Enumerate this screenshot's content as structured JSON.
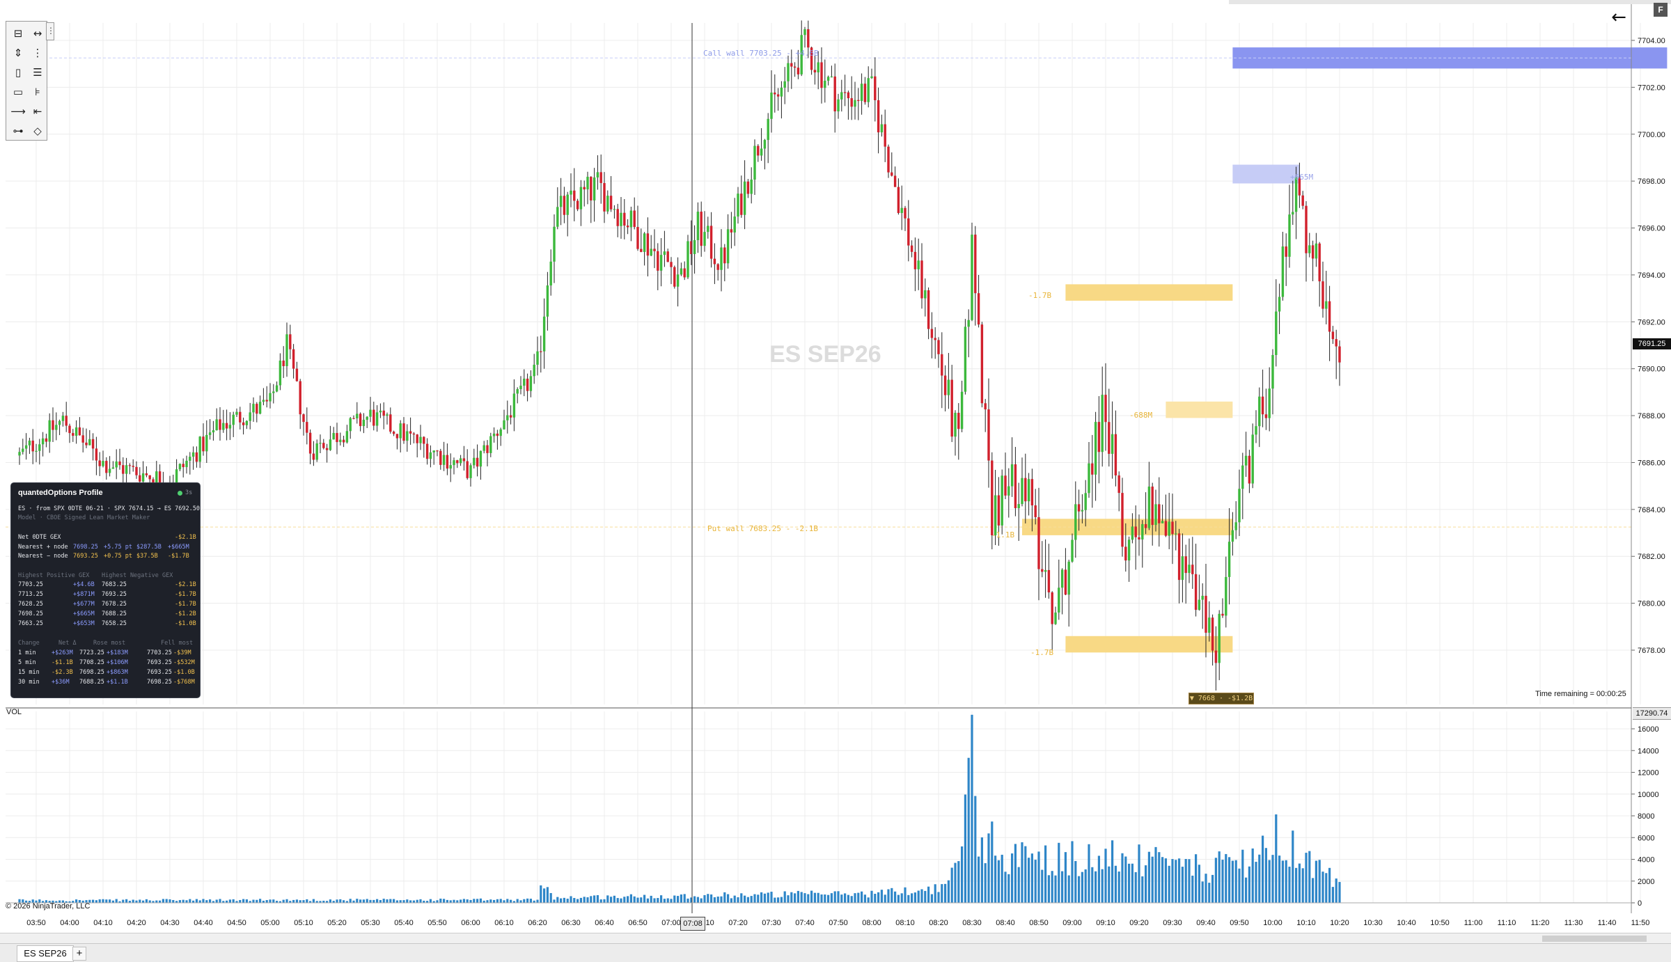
{
  "instrument": {
    "watermark": "ES SEP26",
    "tab_label": "ES SEP26",
    "add_tab": "+"
  },
  "price_axis": {
    "labels": [
      "7704.00",
      "7702.00",
      "7700.00",
      "7698.00",
      "7696.00",
      "7694.00",
      "7692.00",
      "7690.00",
      "7688.00",
      "7686.00",
      "7684.00",
      "7682.00",
      "7680.00",
      "7678.00"
    ],
    "last_price": "7691.25"
  },
  "volume_axis": {
    "labels": [
      "16000",
      "14000",
      "12000",
      "10000",
      "8000",
      "6000",
      "4000",
      "2000",
      "0"
    ],
    "last_value": "17290.74",
    "indicator_label": "VOL",
    "spike_value": 17290.74
  },
  "time_axis": {
    "labels": [
      "03:50",
      "04:00",
      "04:10",
      "04:20",
      "04:30",
      "04:40",
      "04:50",
      "05:00",
      "05:10",
      "05:20",
      "05:30",
      "05:40",
      "05:50",
      "06:00",
      "06:10",
      "06:20",
      "06:30",
      "06:40",
      "06:50",
      "07:00",
      "07:10",
      "07:20",
      "07:30",
      "07:40",
      "07:50",
      "08:00",
      "08:10",
      "08:20",
      "08:30",
      "08:40",
      "08:50",
      "09:00",
      "09:10",
      "09:20",
      "09:30",
      "09:40",
      "09:50",
      "10:00",
      "10:10",
      "10:20",
      "10:30",
      "10:40",
      "10:50",
      "11:00",
      "11:10",
      "11:20",
      "11:30",
      "11:40",
      "11:50"
    ],
    "cursor_time": "07:08"
  },
  "overlays": {
    "call_wall": "Call wall 7703.25 - +4.6B",
    "put_wall": "Put wall 7683.25 - -2.1B",
    "level_labels": {
      "upper_node": "+665M",
      "neg1": "-1.7B",
      "neg2": "-688M",
      "neg3": "-1.1B",
      "neg4": "-1.7B"
    },
    "bottom_badge": "▼ 7668 · -$1.2B",
    "time_remaining": "Time remaining = 00:00:25"
  },
  "panel": {
    "title": "quantedOptions Profile",
    "age": "3s",
    "source_line": "ES · from SPX 0DTE 06-21 · SPX 7674.15 → ES 7692.50",
    "model_line": "Model · CBOE Signed Lean Market Maker",
    "net_label": "Net 0DTE GEX",
    "net_value": "-$2.1B",
    "nearest_pos": {
      "label": "Nearest + node",
      "price": "7698.25",
      "dist": "+5.75 pt",
      "size": "$287.5B",
      "gex": "+$665M"
    },
    "nearest_neg": {
      "label": "Nearest − node",
      "price": "7693.25",
      "dist": "+0.75 pt",
      "size": "$37.5B",
      "gex": "-$1.7B"
    },
    "pos_header": "Highest Positive GEX",
    "neg_header": "Highest Negative GEX",
    "gex_rows": [
      {
        "pos_price": "7703.25",
        "pos_val": "+$4.6B",
        "neg_price": "7683.25",
        "neg_val": "-$2.1B"
      },
      {
        "pos_price": "7713.25",
        "pos_val": "+$871M",
        "neg_price": "7693.25",
        "neg_val": "-$1.7B"
      },
      {
        "pos_price": "7628.25",
        "pos_val": "+$677M",
        "neg_price": "7678.25",
        "neg_val": "-$1.7B"
      },
      {
        "pos_price": "7698.25",
        "pos_val": "+$665M",
        "neg_price": "7688.25",
        "neg_val": "-$1.2B"
      },
      {
        "pos_price": "7663.25",
        "pos_val": "+$653M",
        "neg_price": "7658.25",
        "neg_val": "-$1.0B"
      }
    ],
    "change_header": {
      "c1": "Change",
      "c2": "Net Δ",
      "c3": "Rose most",
      "c4": "Fell most"
    },
    "change_rows": [
      {
        "period": "1 min",
        "net": "+$263M",
        "rose_price": "7723.25",
        "rose_val": "+$183M",
        "fell_price": "7703.25",
        "fell_val": "-$39M"
      },
      {
        "period": "5 min",
        "net": "-$1.1B",
        "rose_price": "7708.25",
        "rose_val": "+$106M",
        "fell_price": "7693.25",
        "fell_val": "-$532M"
      },
      {
        "period": "15 min",
        "net": "-$2.3B",
        "rose_price": "7698.25",
        "rose_val": "+$863M",
        "fell_price": "7693.25",
        "fell_val": "-$1.0B"
      },
      {
        "period": "30 min",
        "net": "+$36M",
        "rose_price": "7688.25",
        "rose_val": "+$1.1B",
        "fell_price": "7698.25",
        "fell_val": "-$768M"
      }
    ]
  },
  "copyright": "© 2026 NinjaTrader, LLC",
  "toolbar": {
    "icons": [
      "ruler-icon",
      "measure-icon",
      "draw-arrows-icon",
      "vertical-line-icon",
      "rectangle-tall-icon",
      "horizontal-lines-icon",
      "rectangle-icon",
      "fib-icon",
      "ray-icon",
      "extended-line-icon",
      "line-segment-icon",
      "diamond-icon"
    ],
    "glyphs": [
      "⊟",
      "↔",
      "⇕",
      "⋮",
      "▯",
      "☰",
      "▭",
      "⊧",
      "⟶",
      "⇤",
      "⊶",
      "◇"
    ]
  },
  "chart_data": {
    "type": "candlestick",
    "ylim": [
      7676.0,
      7705.0
    ],
    "x_start": "03:45",
    "bar_minutes": 1,
    "volume_ylim": [
      0,
      17500
    ],
    "waypoints": [
      {
        "t": "03:45",
        "p": 7686.3
      },
      {
        "t": "03:58",
        "p": 7687.8
      },
      {
        "t": "04:10",
        "p": 7686.0
      },
      {
        "t": "04:30",
        "p": 7685.2
      },
      {
        "t": "04:45",
        "p": 7687.6
      },
      {
        "t": "05:00",
        "p": 7688.5
      },
      {
        "t": "05:05",
        "p": 7691.0
      },
      {
        "t": "05:12",
        "p": 7686.5
      },
      {
        "t": "05:30",
        "p": 7688.0
      },
      {
        "t": "06:00",
        "p": 7685.6
      },
      {
        "t": "06:20",
        "p": 7690.0
      },
      {
        "t": "06:25",
        "p": 7696.5
      },
      {
        "t": "06:38",
        "p": 7697.8
      },
      {
        "t": "06:55",
        "p": 7695.0
      },
      {
        "t": "07:03",
        "p": 7694.0
      },
      {
        "t": "07:08",
        "p": 7696.0
      },
      {
        "t": "07:15",
        "p": 7694.5
      },
      {
        "t": "07:28",
        "p": 7700.5
      },
      {
        "t": "07:40",
        "p": 7703.8
      },
      {
        "t": "07:50",
        "p": 7701.5
      },
      {
        "t": "08:00",
        "p": 7701.8
      },
      {
        "t": "08:20",
        "p": 7690.5
      },
      {
        "t": "08:26",
        "p": 7686.5
      },
      {
        "t": "08:30",
        "p": 7695.0
      },
      {
        "t": "08:36",
        "p": 7684.0
      },
      {
        "t": "08:45",
        "p": 7685.5
      },
      {
        "t": "08:55",
        "p": 7679.5
      },
      {
        "t": "09:05",
        "p": 7686.0
      },
      {
        "t": "09:10",
        "p": 7688.5
      },
      {
        "t": "09:15",
        "p": 7682.5
      },
      {
        "t": "09:25",
        "p": 7684.5
      },
      {
        "t": "09:38",
        "p": 7680.0
      },
      {
        "t": "09:43",
        "p": 7678.0
      },
      {
        "t": "09:50",
        "p": 7684.5
      },
      {
        "t": "09:58",
        "p": 7689.0
      },
      {
        "t": "10:06",
        "p": 7697.8
      },
      {
        "t": "10:13",
        "p": 7694.5
      },
      {
        "t": "10:20",
        "p": 7691.3
      }
    ],
    "volume_profile": [
      {
        "t": "03:45",
        "v": 250
      },
      {
        "t": "06:20",
        "v": 300
      },
      {
        "t": "06:22",
        "v": 2200
      },
      {
        "t": "06:25",
        "v": 500
      },
      {
        "t": "07:30",
        "v": 800
      },
      {
        "t": "08:00",
        "v": 900
      },
      {
        "t": "08:20",
        "v": 1400
      },
      {
        "t": "08:26",
        "v": 3200
      },
      {
        "t": "08:30",
        "v": 17290.74
      },
      {
        "t": "08:31",
        "v": 7500
      },
      {
        "t": "08:40",
        "v": 4300
      },
      {
        "t": "09:10",
        "v": 4400
      },
      {
        "t": "09:40",
        "v": 3200
      },
      {
        "t": "09:58",
        "v": 4700
      },
      {
        "t": "10:01",
        "v": 6200
      },
      {
        "t": "10:10",
        "v": 4000
      },
      {
        "t": "10:20",
        "v": 1800
      }
    ],
    "gex_bars": [
      {
        "price_low": 7702.8,
        "price_high": 7703.7,
        "from": "09:48",
        "to": "11:58",
        "color": "#8a95f0",
        "label": ""
      },
      {
        "price_low": 7697.9,
        "price_high": 7698.7,
        "from": "09:48",
        "to": "10:08",
        "color": "#c6ccf6",
        "label": "+665M"
      },
      {
        "price_low": 7692.9,
        "price_high": 7693.6,
        "from": "08:58",
        "to": "09:48",
        "color": "#f8d985",
        "label": "-1.7B"
      },
      {
        "price_low": 7687.9,
        "price_high": 7688.6,
        "from": "09:28",
        "to": "09:48",
        "color": "#fbe4a8",
        "label": "-688M"
      },
      {
        "price_low": 7682.9,
        "price_high": 7683.6,
        "from": "08:45",
        "to": "09:48",
        "color": "#f8d985",
        "label": "-1.1B"
      },
      {
        "price_low": 7677.9,
        "price_high": 7678.6,
        "from": "08:58",
        "to": "09:48",
        "color": "#f8d985",
        "label": "-1.7B"
      }
    ]
  },
  "colors": {
    "up": "#3cb83c",
    "down": "#d1202c",
    "volume": "#2e86c8",
    "grid": "#ececec",
    "crosshair": "#333333"
  }
}
